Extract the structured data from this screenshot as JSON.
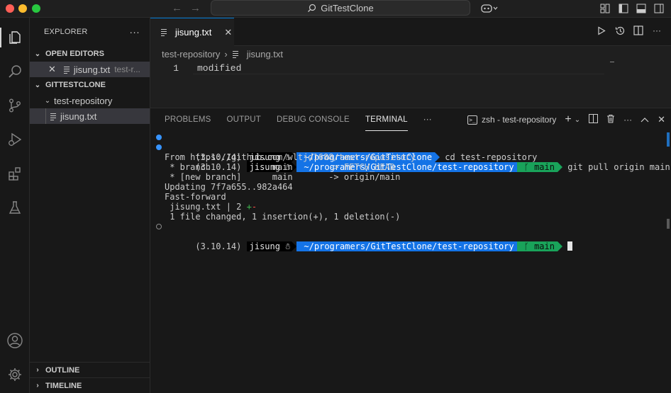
{
  "titlebar": {
    "search_label": "GitTestClone"
  },
  "sidebar": {
    "title": "EXPLORER",
    "open_editors": {
      "label": "OPEN EDITORS",
      "items": [
        {
          "name": "jisung.txt",
          "description": "test-r..."
        }
      ]
    },
    "workspace": {
      "label": "GITTESTCLONE",
      "folder": "test-repository",
      "file": "jisung.txt"
    },
    "outline_label": "OUTLINE",
    "timeline_label": "TIMELINE"
  },
  "editor": {
    "tab_label": "jisung.txt",
    "breadcrumb": [
      "test-repository",
      "jisung.txt"
    ],
    "lines": [
      {
        "number": "1",
        "text": "modified"
      }
    ]
  },
  "panel": {
    "tabs": [
      "PROBLEMS",
      "OUTPUT",
      "DEBUG CONSOLE",
      "TERMINAL"
    ],
    "active_tab": "TERMINAL",
    "terminal_name": "zsh - test-repository"
  },
  "terminal": {
    "prompt1": {
      "env": "(3.10.14)",
      "user": "jisung ☃",
      "path": "~/programers/GitTestClone",
      "command": "cd test-repository"
    },
    "prompt2": {
      "env": "(3.10.14)",
      "user": "jisung ☃",
      "path": "~/programers/GitTestClone/test-repository",
      "branch": "ᚴ main",
      "command": "git pull origin main"
    },
    "output": [
      "From https://github.com/wltjd1688/test-repository",
      " * branch            main       -> FETCH_HEAD",
      " * [new branch]      main       -> origin/main",
      "Updating 7f7a655..982a464",
      "Fast-forward",
      " jisung.txt | 2 ",
      " 1 file changed, 1 insertion(+), 1 deletion(-)"
    ],
    "diff_plus": "+",
    "diff_minus": "-",
    "prompt3": {
      "env": "(3.10.14)",
      "user": "jisung ☃",
      "path": "~/programers/GitTestClone/test-repository",
      "branch": "ᚴ main"
    }
  },
  "colors": {
    "accent": "#0078d4",
    "path_bg": "#1473e6",
    "git_bg": "#19a35a"
  }
}
